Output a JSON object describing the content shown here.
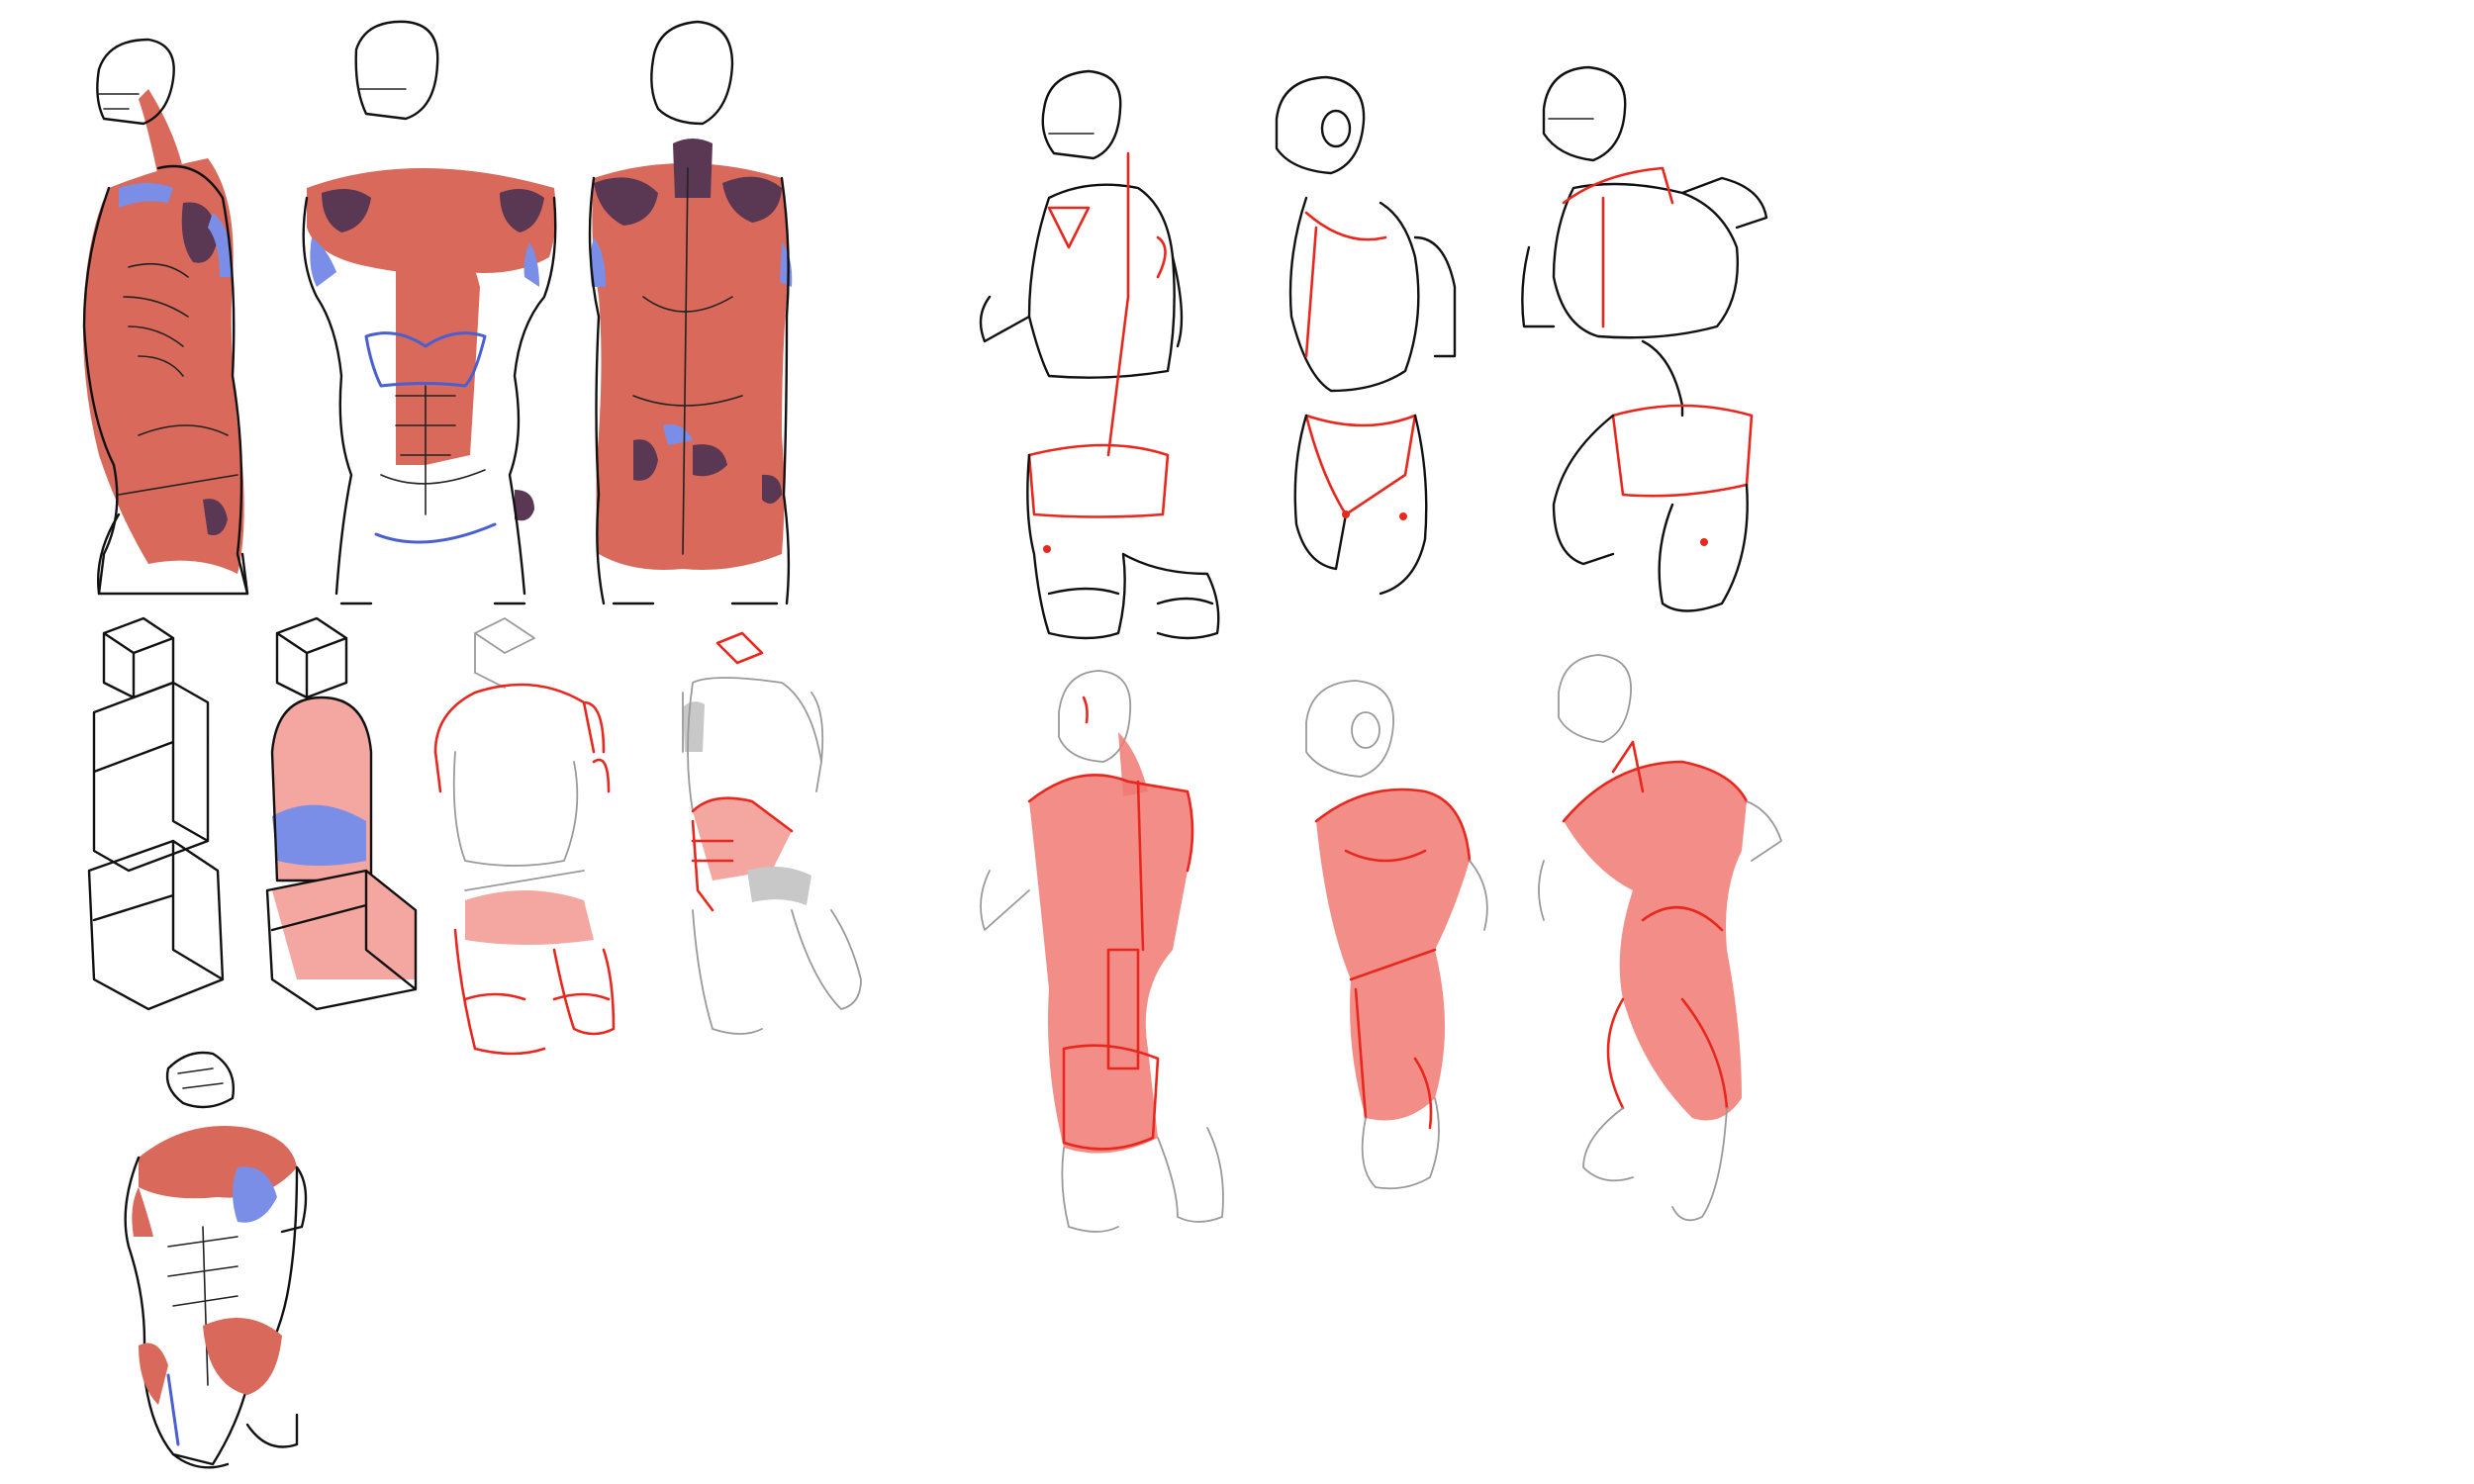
{
  "sheet": {
    "colors": {
      "ink": "#111111",
      "muscle": "#d9695a",
      "dark_muscle": "#5a3752",
      "blue_accent": "#7a8ee8",
      "red_construction": "#e8281e",
      "pink_fill": "#f4a7a0",
      "ghost_line": "#9a9a9a"
    },
    "figures_count": 15
  }
}
